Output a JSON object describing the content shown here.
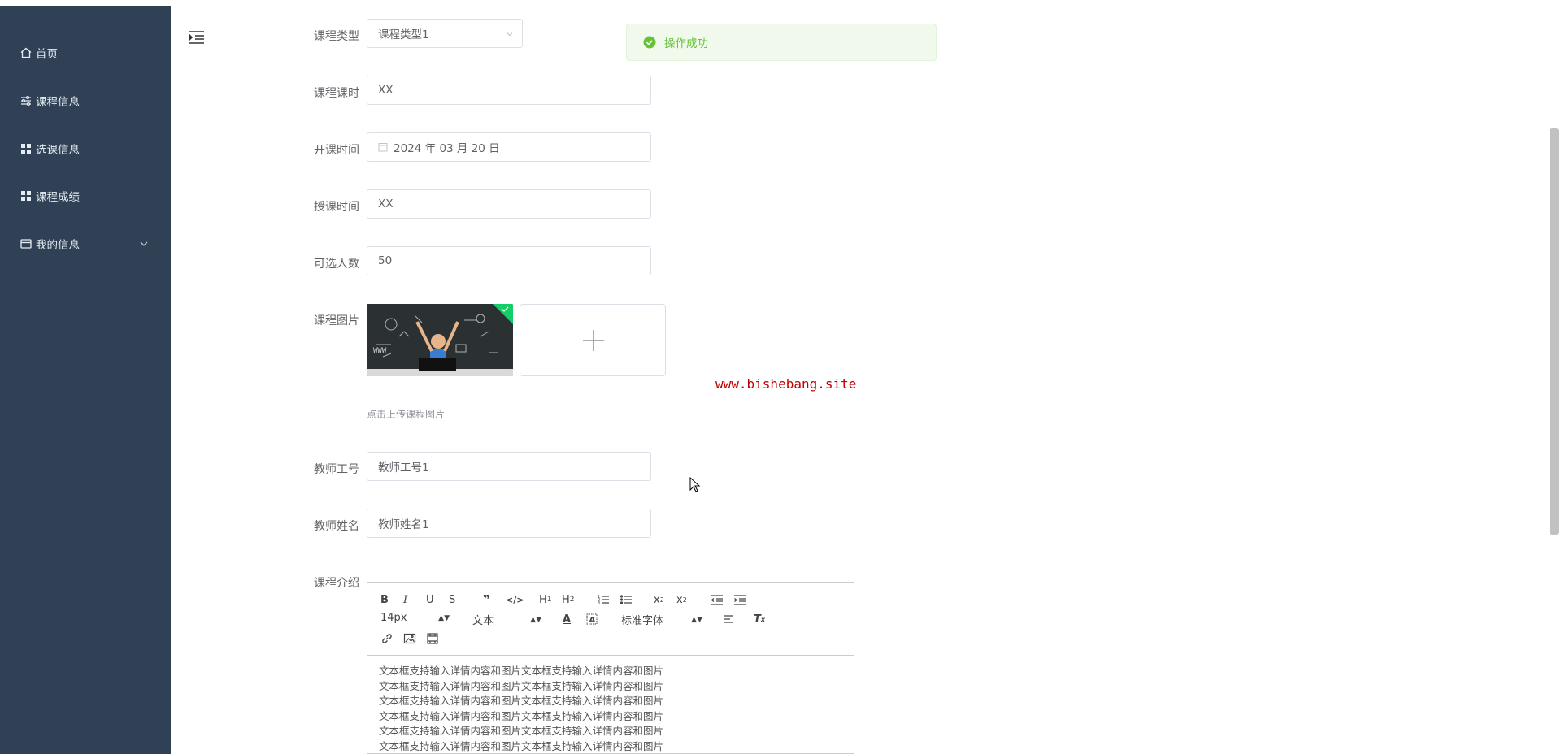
{
  "sidebar": {
    "items": [
      {
        "label": "首页",
        "icon": "home-icon"
      },
      {
        "label": "课程信息",
        "icon": "sliders-icon"
      },
      {
        "label": "选课信息",
        "icon": "grid-icon"
      },
      {
        "label": "课程成绩",
        "icon": "grid-icon"
      },
      {
        "label": "我的信息",
        "icon": "wallet-icon"
      }
    ],
    "bg_color": "#304156"
  },
  "toast": {
    "message": "操作成功",
    "color": "#67c23a"
  },
  "form": {
    "course_type": {
      "label": "课程类型",
      "value": "课程类型1"
    },
    "course_hours": {
      "label": "课程课时",
      "value": "XX"
    },
    "start_date": {
      "label": "开课时间",
      "value": "2024 年 03 月 20 日"
    },
    "teaching_time": {
      "label": "授课时间",
      "value": "XX"
    },
    "capacity": {
      "label": "可选人数",
      "value": "50"
    },
    "course_image": {
      "label": "课程图片",
      "tip": "点击上传课程图片"
    },
    "teacher_id": {
      "label": "教师工号",
      "value": "教师工号1"
    },
    "teacher_name": {
      "label": "教师姓名",
      "value": "教师姓名1"
    },
    "intro": {
      "label": "课程介绍",
      "toolbar": {
        "font_size": "14px",
        "header": "文本",
        "font": "标准字体"
      },
      "lines": [
        "文本框支持输入详情内容和图片文本框支持输入详情内容和图片",
        "文本框支持输入详情内容和图片文本框支持输入详情内容和图片",
        "文本框支持输入详情内容和图片文本框支持输入详情内容和图片",
        "文本框支持输入详情内容和图片文本框支持输入详情内容和图片",
        "文本框支持输入详情内容和图片文本框支持输入详情内容和图片",
        "文本框支持输入详情内容和图片文本框支持输入详情内容和图片"
      ]
    }
  },
  "watermark": "www.bishebang.site"
}
